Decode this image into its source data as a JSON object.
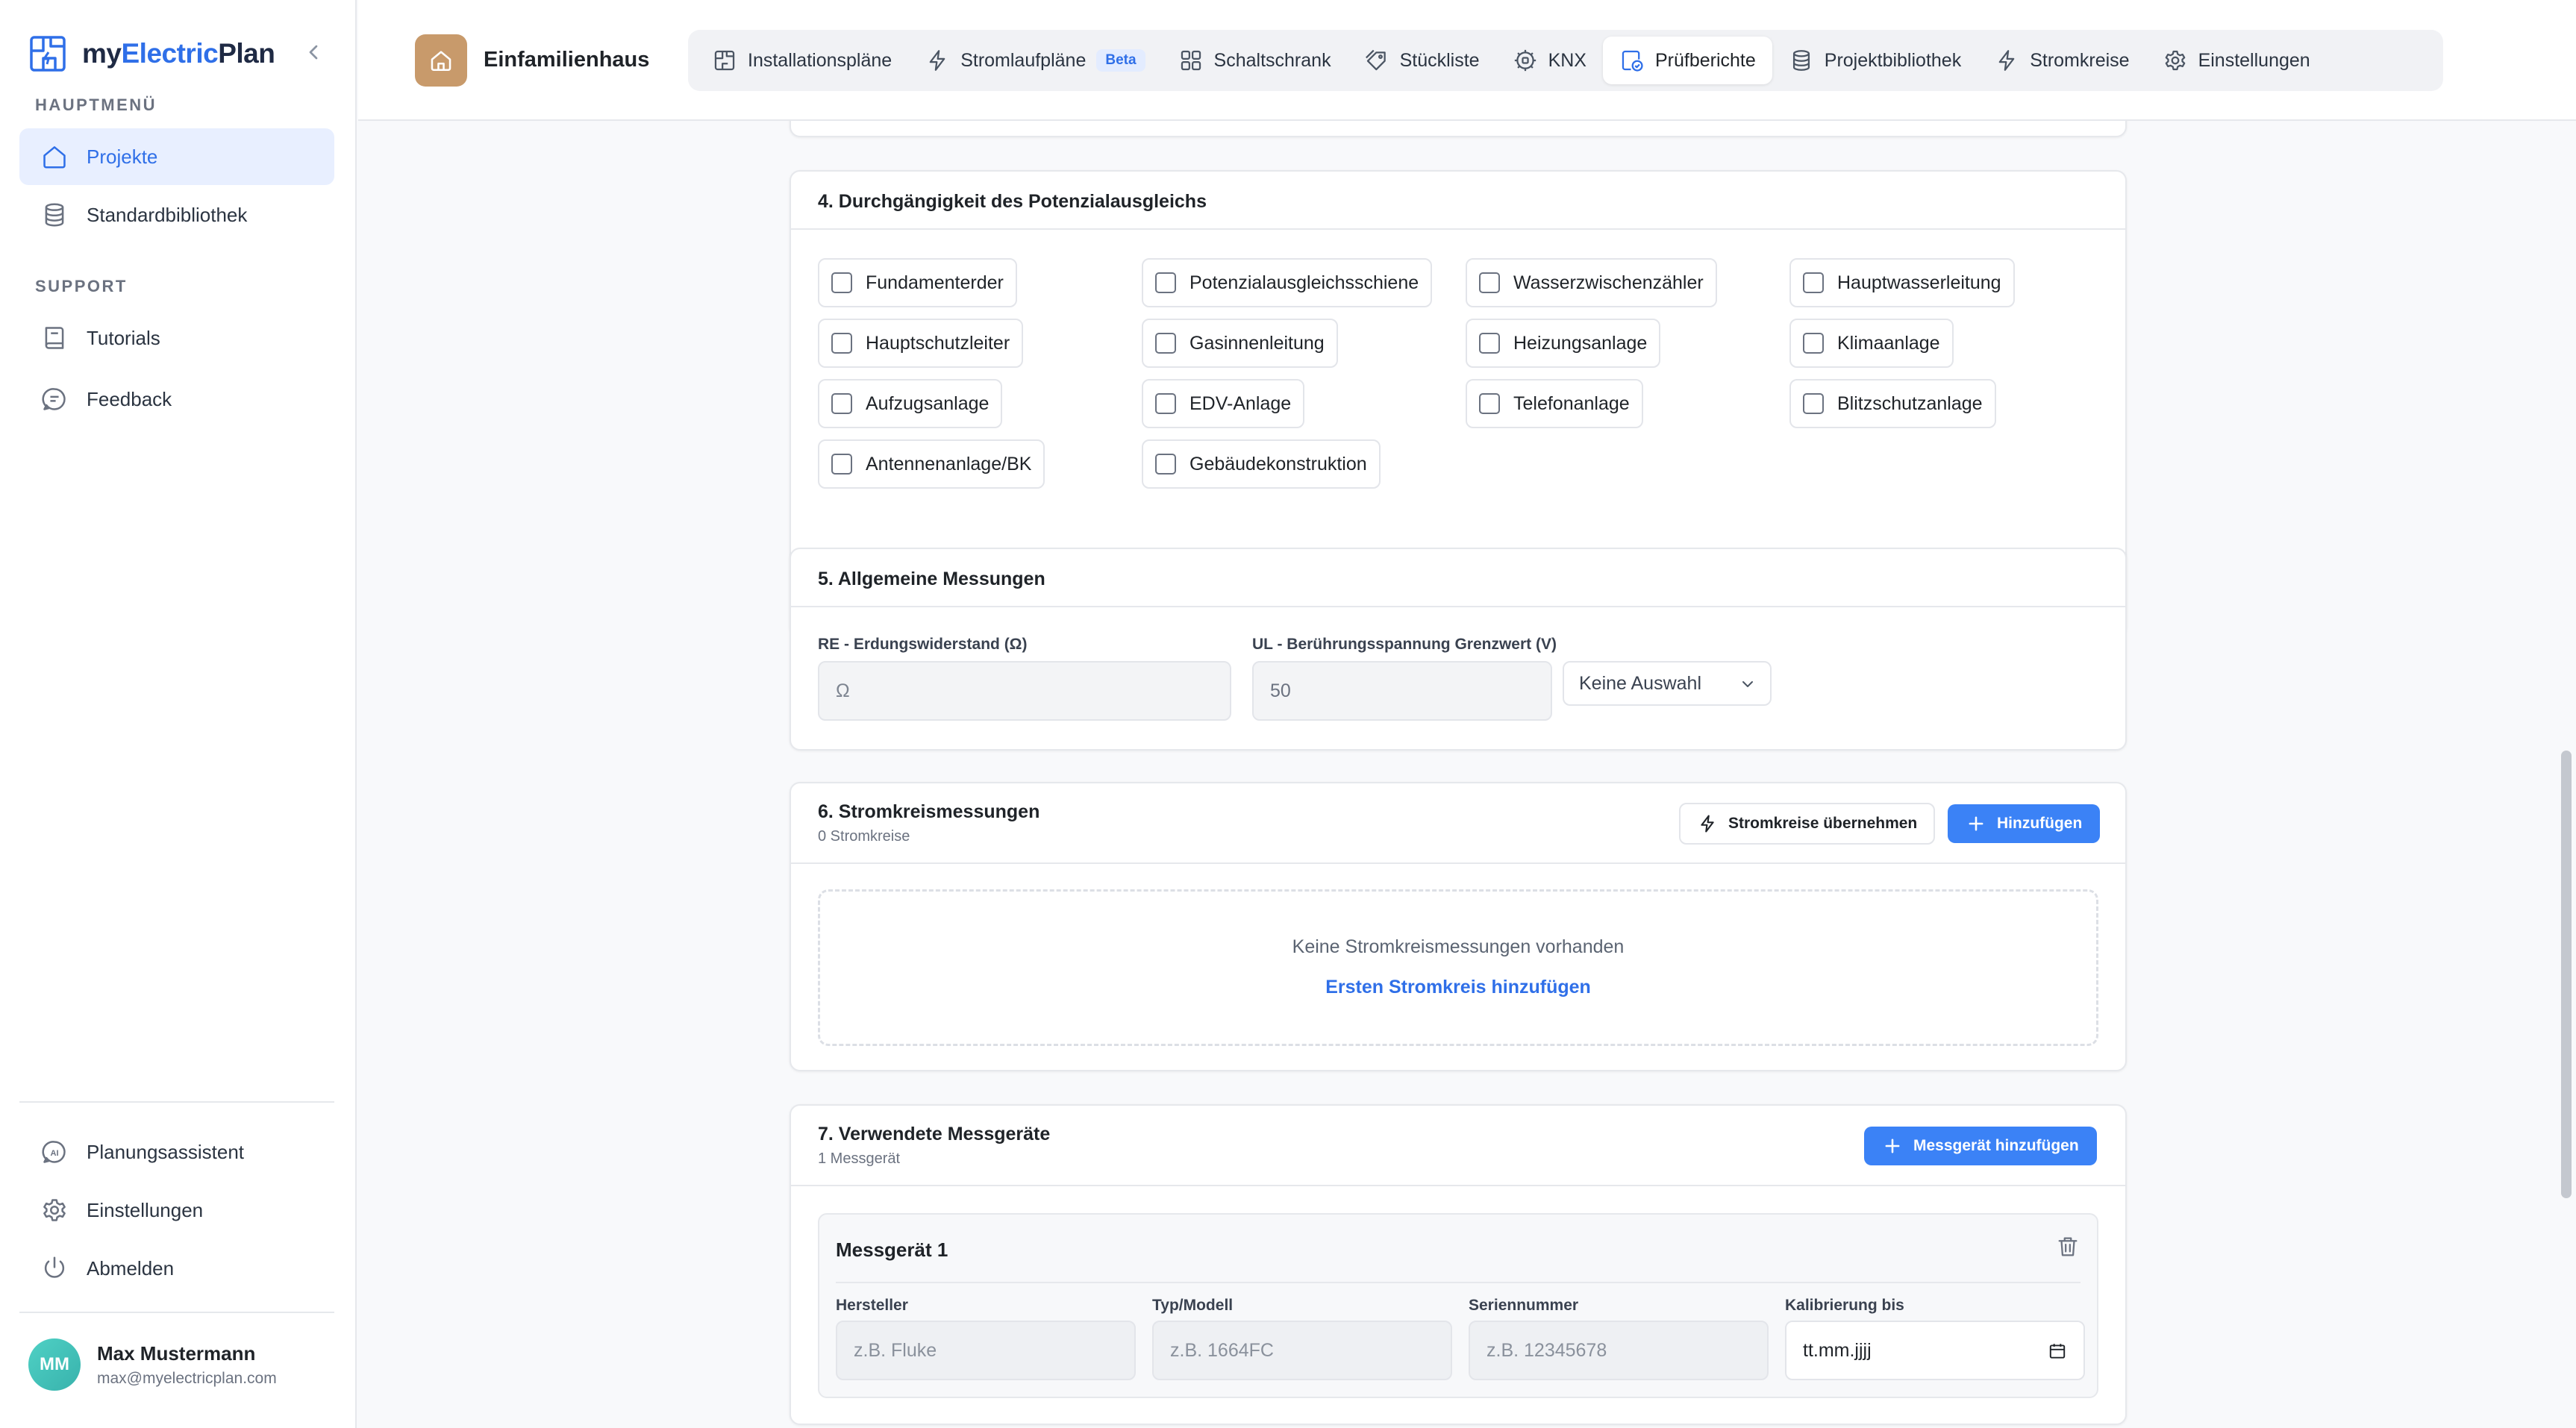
{
  "app": {
    "brand_prefix": "my",
    "brand_accent": "Electric",
    "brand_suffix": "Plan"
  },
  "sidebar": {
    "main_section_label": "HAUPTMENÜ",
    "support_section_label": "SUPPORT",
    "main_items": [
      {
        "label": "Projekte",
        "icon": "home-icon",
        "active": true
      },
      {
        "label": "Standardbibliothek",
        "icon": "database-icon",
        "active": false
      }
    ],
    "support_items": [
      {
        "label": "Tutorials",
        "icon": "book-icon"
      },
      {
        "label": "Feedback",
        "icon": "message-icon"
      }
    ],
    "bottom_items": [
      {
        "label": "Planungsassistent",
        "icon": "ai-assistant-icon"
      },
      {
        "label": "Einstellungen",
        "icon": "gear-icon"
      },
      {
        "label": "Abmelden",
        "icon": "power-icon"
      }
    ],
    "user": {
      "initials": "MM",
      "name": "Max Mustermann",
      "email": "max@myelectricplan.com"
    }
  },
  "topbar": {
    "project_name": "Einfamilienhaus",
    "tabs": [
      {
        "label": "Installationspläne",
        "icon": "floorplan-icon"
      },
      {
        "label": "Stromlaufpläne",
        "icon": "bolt-icon",
        "badge": "Beta"
      },
      {
        "label": "Schaltschrank",
        "icon": "grid-icon"
      },
      {
        "label": "Stückliste",
        "icon": "tag-icon"
      },
      {
        "label": "KNX",
        "icon": "chip-icon"
      },
      {
        "label": "Prüfberichte",
        "icon": "report-check-icon",
        "active": true
      },
      {
        "label": "Projektbibliothek",
        "icon": "database-icon"
      },
      {
        "label": "Stromkreise",
        "icon": "bolt-icon"
      },
      {
        "label": "Einstellungen",
        "icon": "gear-icon"
      }
    ]
  },
  "section4": {
    "title": "4. Durchgängigkeit des Potenzialausgleichs",
    "checkboxes": [
      {
        "label": "Fundamenterder",
        "checked": false
      },
      {
        "label": "Potenzialausgleichsschiene",
        "checked": false
      },
      {
        "label": "Wasserzwischenzähler",
        "checked": false
      },
      {
        "label": "Hauptwasserleitung",
        "checked": false
      },
      {
        "label": "Hauptschutzleiter",
        "checked": false
      },
      {
        "label": "Gasinnenleitung",
        "checked": false
      },
      {
        "label": "Heizungsanlage",
        "checked": false
      },
      {
        "label": "Klimaanlage",
        "checked": false
      },
      {
        "label": "Aufzugsanlage",
        "checked": false
      },
      {
        "label": "EDV-Anlage",
        "checked": false
      },
      {
        "label": "Telefonanlage",
        "checked": false
      },
      {
        "label": "Blitzschutzanlage",
        "checked": false
      },
      {
        "label": "Antennenanlage/BK",
        "checked": false
      },
      {
        "label": "Gebäudekonstruktion",
        "checked": false
      }
    ]
  },
  "section5": {
    "title": "5. Allgemeine Messungen",
    "re_label": "RE - Erdungswiderstand (Ω)",
    "re_placeholder": "Ω",
    "ul_label": "UL - Berührungsspannung Grenzwert (V)",
    "ul_value": "50",
    "ul_select": "Keine Auswahl"
  },
  "section6": {
    "title": "6. Stromkreismessungen",
    "subtitle": "0 Stromkreise",
    "import_button": "Stromkreise übernehmen",
    "add_button": "Hinzufügen",
    "empty_text": "Keine Stromkreismessungen vorhanden",
    "empty_link": "Ersten Stromkreis hinzufügen"
  },
  "section7": {
    "title": "7. Verwendete Messgeräte",
    "subtitle": "1 Messgerät",
    "add_button": "Messgerät hinzufügen",
    "device": {
      "title": "Messgerät 1",
      "manufacturer_label": "Hersteller",
      "manufacturer_placeholder": "z.B. Fluke",
      "model_label": "Typ/Modell",
      "model_placeholder": "z.B. 1664FC",
      "serial_label": "Seriennummer",
      "serial_placeholder": "z.B. 12345678",
      "calibration_label": "Kalibrierung bis",
      "calibration_placeholder": "tt.mm.jjjj"
    }
  },
  "colors": {
    "accent": "#2f6fe8",
    "primary_button": "#3b82f6",
    "project_badge": "#c89a6b",
    "avatar": "#4fd1c5"
  }
}
